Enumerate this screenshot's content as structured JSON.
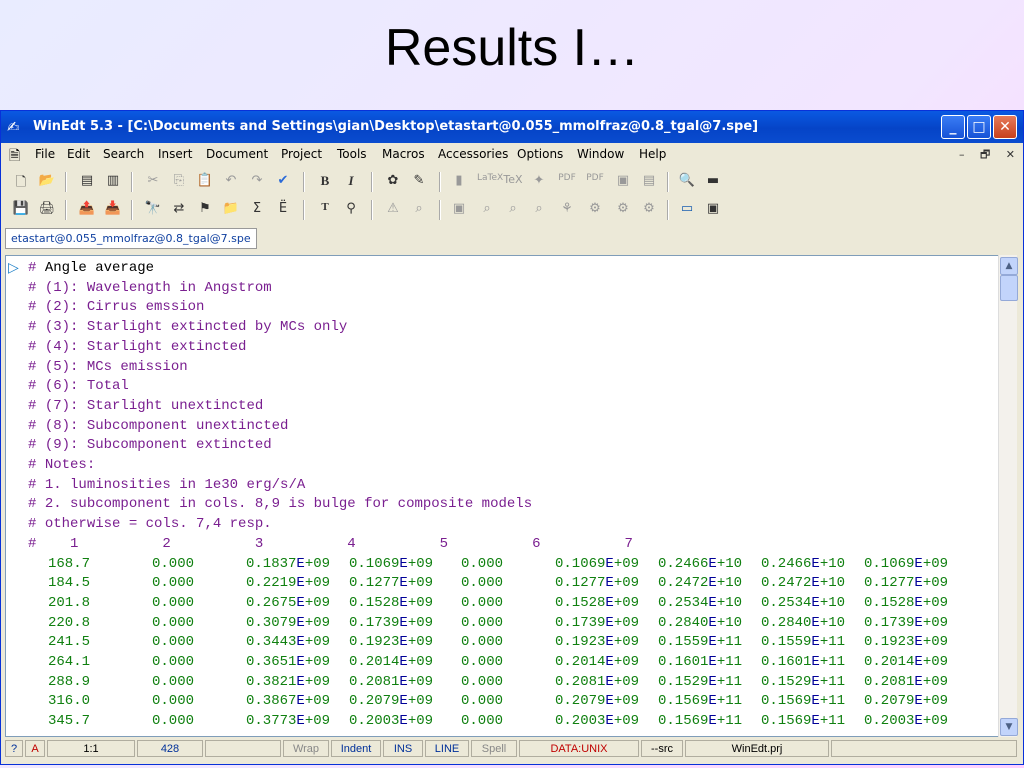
{
  "slide": {
    "title": "Results I…"
  },
  "window": {
    "title": "WinEdt 5.3 - [C:\\Documents and Settings\\gian\\Desktop\\etastart@0.055_mmolfraz@0.8_tgal@7.spe]",
    "minimize": "_",
    "maximize": "□",
    "close": "✕"
  },
  "menu": {
    "items": [
      {
        "label": "File"
      },
      {
        "label": "Edit"
      },
      {
        "label": "Search"
      },
      {
        "label": "Insert"
      },
      {
        "label": "Document"
      },
      {
        "label": "Project"
      },
      {
        "label": "Tools"
      },
      {
        "label": "Macros"
      },
      {
        "label": "Accessories"
      },
      {
        "label": "Options"
      },
      {
        "label": "Window"
      },
      {
        "label": "Help"
      }
    ],
    "mdi_min": "–",
    "mdi_restore": "🗗",
    "mdi_close": "✕"
  },
  "toolbar": {
    "row1": [
      "🗋",
      "📂",
      "▤",
      "▥",
      "✂",
      "⎘",
      "📋",
      "↶",
      "↷",
      "✔",
      "B",
      "I",
      "✿",
      "✎",
      "▮",
      "LaTeX",
      "TeX",
      "✦",
      "PDF",
      "PDF",
      "▣",
      "▤",
      "🔍",
      "▬"
    ],
    "row2": [
      "💾",
      "🖨",
      "📤",
      "📥",
      "🔭",
      "⇄",
      "⚑",
      "📁",
      "Σ",
      "Ë",
      "T",
      "⚲",
      "⚠",
      "⌕",
      "▣",
      "⌕",
      "⌕",
      "⌕",
      "⚘",
      "⚙",
      "⚙",
      "⚙",
      "▭",
      "▣"
    ]
  },
  "tab": {
    "label": "etastart@0.055_mmolfraz@0.8_tgal@7.spe"
  },
  "editor": {
    "comment_lines": [
      "Angle average",
      "(1): Wavelength in Angstrom",
      "(2): Cirrus emssion",
      "(3): Starlight extincted by MCs only",
      "(4): Starlight extincted",
      "(5): MCs emission",
      "(6): Total",
      "(7): Starlight unextincted",
      "(8): Subcomponent unextincted",
      "(9): Subcomponent extincted",
      "Notes:",
      "1. luminosities in 1e30 erg/s/A",
      "2. subcomponent in cols. 8,9 is bulge for composite models",
      "otherwise = cols. 7,4 resp."
    ],
    "column_header": "#    1          2          3          4          5          6          7",
    "rows": [
      [
        "168.7",
        "0.000",
        "0.1837E+09",
        "0.1069E+09",
        "0.000",
        "0.1069E+09",
        "0.2466E+10",
        "0.2466E+10",
        "0.1069E+09"
      ],
      [
        "184.5",
        "0.000",
        "0.2219E+09",
        "0.1277E+09",
        "0.000",
        "0.1277E+09",
        "0.2472E+10",
        "0.2472E+10",
        "0.1277E+09"
      ],
      [
        "201.8",
        "0.000",
        "0.2675E+09",
        "0.1528E+09",
        "0.000",
        "0.1528E+09",
        "0.2534E+10",
        "0.2534E+10",
        "0.1528E+09"
      ],
      [
        "220.8",
        "0.000",
        "0.3079E+09",
        "0.1739E+09",
        "0.000",
        "0.1739E+09",
        "0.2840E+10",
        "0.2840E+10",
        "0.1739E+09"
      ],
      [
        "241.5",
        "0.000",
        "0.3443E+09",
        "0.1923E+09",
        "0.000",
        "0.1923E+09",
        "0.1559E+11",
        "0.1559E+11",
        "0.1923E+09"
      ],
      [
        "264.1",
        "0.000",
        "0.3651E+09",
        "0.2014E+09",
        "0.000",
        "0.2014E+09",
        "0.1601E+11",
        "0.1601E+11",
        "0.2014E+09"
      ],
      [
        "288.9",
        "0.000",
        "0.3821E+09",
        "0.2081E+09",
        "0.000",
        "0.2081E+09",
        "0.1529E+11",
        "0.1529E+11",
        "0.2081E+09"
      ],
      [
        "316.0",
        "0.000",
        "0.3867E+09",
        "0.2079E+09",
        "0.000",
        "0.2079E+09",
        "0.1569E+11",
        "0.1569E+11",
        "0.2079E+09"
      ],
      [
        "345.7",
        "0.000",
        "0.3773E+09",
        "0.2003E+09",
        "0.000",
        "0.2003E+09",
        "0.1569E+11",
        "0.1569E+11",
        "0.2003E+09"
      ]
    ]
  },
  "status": {
    "help": "?",
    "mode": "A",
    "position": "1:1",
    "lines": "428",
    "wrap": "Wrap",
    "indent": "Indent",
    "ins": "INS",
    "line": "LINE",
    "spell": "Spell",
    "format": "DATA:UNIX",
    "src": "--src",
    "project": "WinEdt.prj"
  }
}
